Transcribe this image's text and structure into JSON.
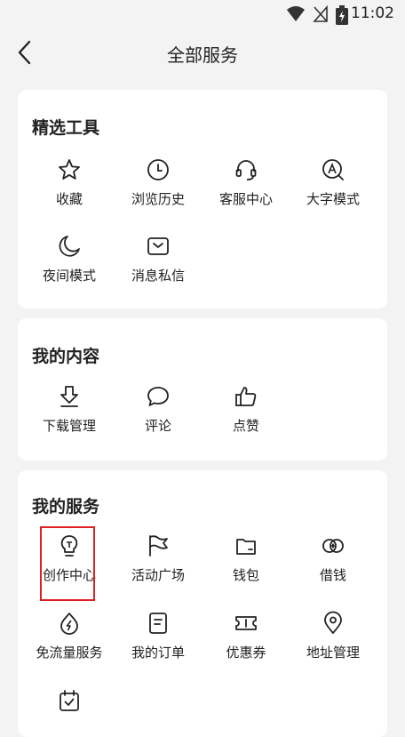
{
  "status_bar": {
    "time": "11:02",
    "icons": [
      "wifi-icon",
      "signal-off-icon",
      "battery-charging-icon"
    ]
  },
  "header": {
    "title": "全部服务",
    "back_icon": "back-arrow-icon"
  },
  "sections": [
    {
      "title": "精选工具",
      "items": [
        {
          "label": "收藏",
          "icon": "star-icon"
        },
        {
          "label": "浏览历史",
          "icon": "clock-icon"
        },
        {
          "label": "客服中心",
          "icon": "headset-icon"
        },
        {
          "label": "大字模式",
          "icon": "font-size-icon"
        },
        {
          "label": "夜间模式",
          "icon": "moon-icon"
        },
        {
          "label": "消息私信",
          "icon": "message-icon"
        }
      ]
    },
    {
      "title": "我的内容",
      "items": [
        {
          "label": "下载管理",
          "icon": "download-icon"
        },
        {
          "label": "评论",
          "icon": "comment-icon"
        },
        {
          "label": "点赞",
          "icon": "thumbs-up-icon"
        }
      ]
    },
    {
      "title": "我的服务",
      "items": [
        {
          "label": "创作中心",
          "icon": "lightbulb-icon"
        },
        {
          "label": "活动广场",
          "icon": "flag-icon"
        },
        {
          "label": "钱包",
          "icon": "wallet-icon"
        },
        {
          "label": "借钱",
          "icon": "coins-icon"
        },
        {
          "label": "免流量服务",
          "icon": "data-free-icon"
        },
        {
          "label": "我的订单",
          "icon": "order-icon"
        },
        {
          "label": "优惠券",
          "icon": "coupon-icon"
        },
        {
          "label": "地址管理",
          "icon": "location-pin-icon"
        },
        {
          "label": "",
          "icon": "calendar-check-icon"
        }
      ]
    }
  ],
  "colors": {
    "background": "#f3f3f3",
    "card": "#ffffff",
    "highlight": "#e02020",
    "icon": "#222222"
  }
}
